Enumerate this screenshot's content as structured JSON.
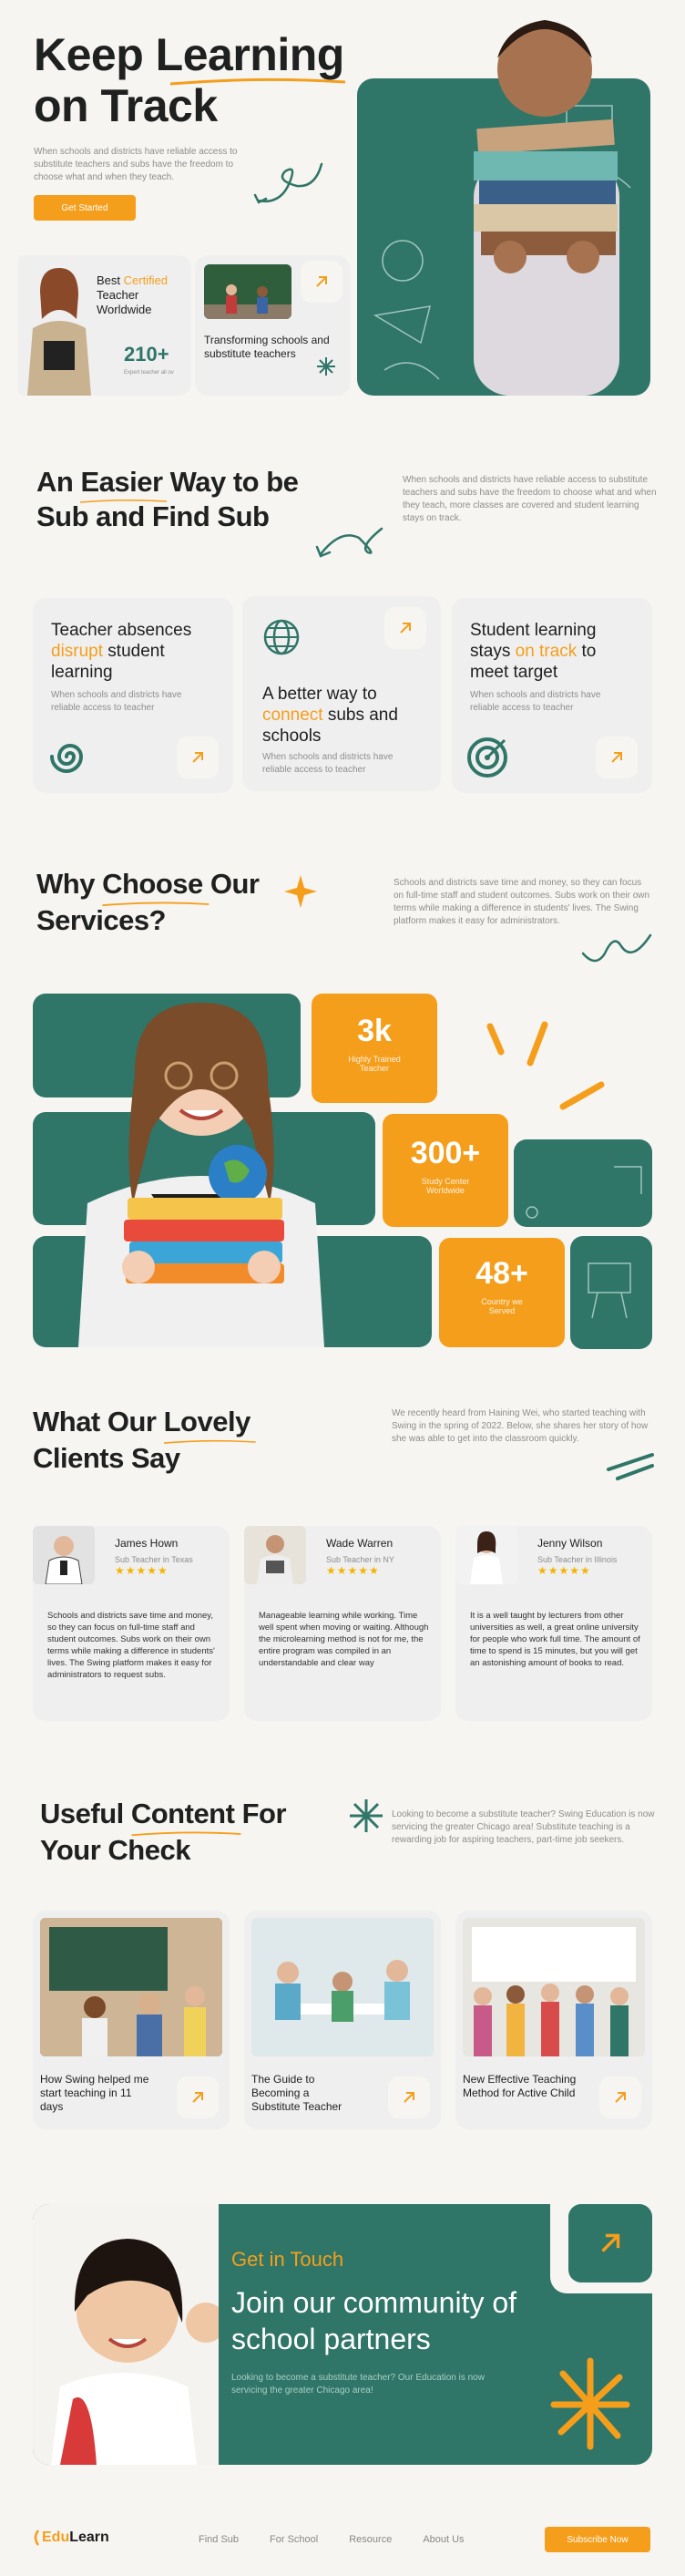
{
  "hero": {
    "title_line1_a": "Keep ",
    "title_line1_b": "Learning",
    "title_line2": "on Track",
    "desc": "When schools and districts have reliable access to substitute teachers and subs have the freedom to choose what and when they teach.",
    "cta": "Get Started",
    "badge_a": "Best ",
    "badge_b": "Certified",
    "badge_c": "Teacher Worldwide",
    "stat": "210+",
    "stat_label": "Expert teacher all ov",
    "transform_text": "Transforming schools and substitute teachers"
  },
  "easier": {
    "title_line1_a": "An ",
    "title_line1_b": "Easier",
    "title_line1_c": " Way to be",
    "title_line2": "Sub and Find Sub",
    "desc": "When schools and districts have reliable access to substitute teachers and subs have the freedom to choose what and when they teach, more classes are covered and student learning stays on track.",
    "card1_a": "Teacher absences ",
    "card1_b": "disrupt",
    "card1_c": " student learning",
    "card1_desc": "When schools and districts have reliable access to teacher",
    "card2_a": "A better way to ",
    "card2_b": "connect",
    "card2_c": " subs and schools",
    "card2_desc": "When schools and districts have reliable access to teacher",
    "card3_a": "Student learning stays ",
    "card3_b": "on track",
    "card3_c": " to meet target",
    "card3_desc": "When schools and districts have reliable access to teacher"
  },
  "services": {
    "title_line1_a": "Why ",
    "title_line1_b": "Choose",
    "title_line1_c": " Our",
    "title_line2": "Services?",
    "desc": "Schools and districts save time and money, so they can focus on full-time staff and student outcomes. Subs work on their own terms while making a difference in students' lives. The Swing platform makes it easy for administrators.",
    "stat1": "3k",
    "stat1_label": "Highly Trained Teacher",
    "stat2": "300+",
    "stat2_label": "Study Center Worldwide",
    "stat3": "48+",
    "stat3_label": "Country we Served"
  },
  "testimonials": {
    "title_line1_a": "What Our ",
    "title_line1_b": "Lovely",
    "title_line2": "Clients Say",
    "desc": "We recently heard from Haining Wei, who started teaching with Swing in the spring of 2022. Below, she shares her story of how she was able to get into the classroom quickly.",
    "items": [
      {
        "name": "James Hown",
        "role": "Sub Teacher in Texas",
        "stars": "★★★★★",
        "text": "Schools and districts save time and money, so they can focus on full-time staff and student outcomes. Subs work on their own terms while making a difference in students' lives. The Swing platform makes it easy for administrators to request subs."
      },
      {
        "name": "Wade Warren",
        "role": "Sub Teacher in NY",
        "stars": "★★★★★",
        "text": "Manageable learning while working. Time well spent when moving or waiting. Although the microlearning method is not for me, the entire program was compiled in an understandable and clear way"
      },
      {
        "name": "Jenny Wilson",
        "role": "Sub Teacher in Illinois",
        "stars": "★★★★★",
        "text": "It is a well taught by lecturers from other universities as well, a great online university for people who work full time. The amount of time to spend is 15 minutes, but you will get an astonishing amount of books to read."
      }
    ]
  },
  "content": {
    "title_line1_a": "Useful ",
    "title_line1_b": "Content",
    "title_line1_c": " For",
    "title_line2": "Your Check",
    "desc": "Looking to become a substitute teacher? Swing Education is now servicing the greater Chicago area! Substitute teaching is a rewarding job for aspiring teachers, part-time job seekers.",
    "items": [
      {
        "title": "How Swing helped me start teaching in 11 days"
      },
      {
        "title": "The Guide to Becoming a Substitute Teacher"
      },
      {
        "title": "New Effective Teaching Method for Active Child"
      }
    ]
  },
  "contact": {
    "kicker": "Get in Touch",
    "title": "Join our community of school partners",
    "desc": "Looking to become a substitute teacher? Our Education is now servicing the greater Chicago area!"
  },
  "footer": {
    "logo_a": "Edu",
    "logo_b": "Learn",
    "nav": [
      "Find Sub",
      "For School",
      "Resource",
      "About Us"
    ],
    "cta": "Subscribe Now"
  },
  "colors": {
    "green": "#2f7568",
    "orange": "#f59e1b",
    "background": "#f6f5f1",
    "card": "#efefef"
  }
}
